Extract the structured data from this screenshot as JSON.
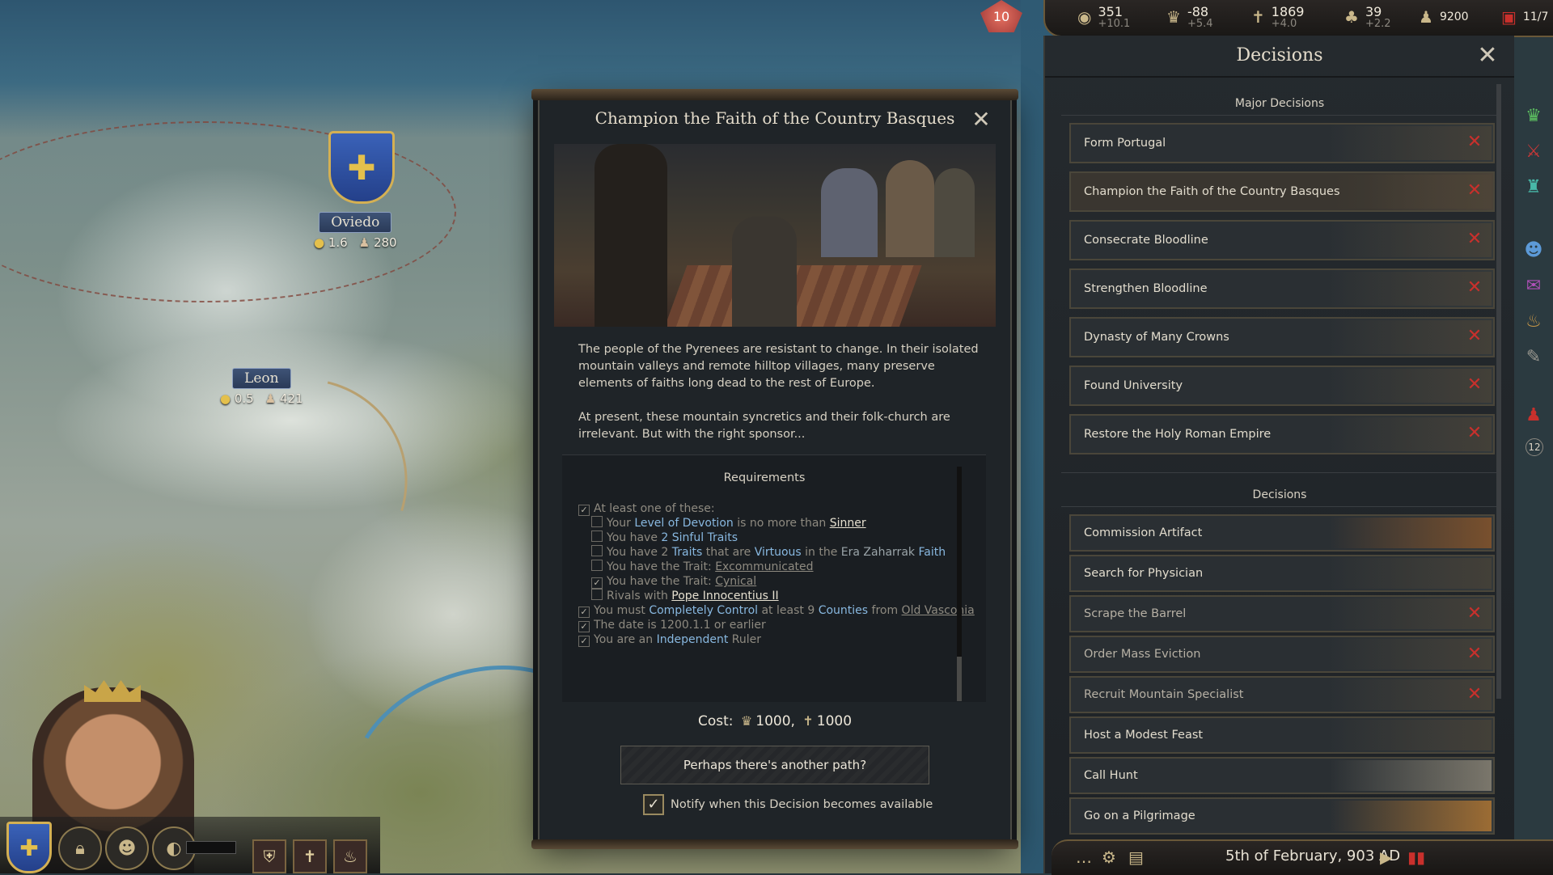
{
  "map": {
    "holdings": [
      {
        "name": "Oviedo",
        "gold": "1.6",
        "levy": "280"
      },
      {
        "name": "Leon",
        "gold": "0.5",
        "levy": "421"
      }
    ]
  },
  "topbar": {
    "gem_value": "10",
    "resources": [
      {
        "icon": "gold-icon",
        "value": "351",
        "delta": "+10.1"
      },
      {
        "icon": "prestige-icon",
        "value": "-88",
        "delta": "+5.4"
      },
      {
        "icon": "piety-icon",
        "value": "1869",
        "delta": "+4.0"
      },
      {
        "icon": "renown-icon",
        "value": "39",
        "delta": "+2.2"
      },
      {
        "icon": "soldiers-icon",
        "value": "9200"
      },
      {
        "icon": "domain-icon",
        "value": "11/7"
      }
    ]
  },
  "dialog": {
    "title": "Champion the Faith of the Country Basques",
    "close": "✕",
    "description": [
      "The people of the Pyrenees are resistant to change. In their isolated mountain valleys and remote hilltop villages, many preserve elements of faiths long dead to the rest of Europe.",
      "At present, these mountain syncretics and their folk-church are irrelevant. But with the right sponsor..."
    ],
    "requirements_title": "Requirements",
    "requirements": {
      "at_least": "At least one of these:",
      "r1": {
        "a": "Your ",
        "b": "Level of Devotion",
        "c": " is no more than ",
        "d": "Sinner"
      },
      "r2": {
        "a": "You have ",
        "b": "2 Sinful Traits"
      },
      "r3": {
        "a": "You have 2 ",
        "b": "Traits",
        "c": " that are ",
        "d": "Virtuous",
        "e": " in the ",
        "f": "Era Zaharrak",
        "g": " Faith"
      },
      "r4": {
        "a": "You have the Trait: ",
        "b": "Excommunicated"
      },
      "r5": {
        "a": "You have the Trait: ",
        "b": "Cynical"
      },
      "r6": {
        "a": "Rivals with ",
        "b": "Pope Innocentius II"
      },
      "r7": {
        "a": "You must ",
        "b": "Completely Control",
        "c": " at least 9 ",
        "d": "Counties",
        "e": " from ",
        "f": "Old Vasconia"
      },
      "r8": "The date is 1200.1.1 or earlier",
      "r9": {
        "a": "You are an ",
        "b": "Independent",
        "c": " Ruler"
      }
    },
    "cost": {
      "label": "Cost:",
      "prestige": "1000,",
      "piety": "1000"
    },
    "path_button": "Perhaps there's another path?",
    "notify_label": "Notify when this Decision becomes available",
    "notify_checked": true
  },
  "panel": {
    "title": "Decisions",
    "close": "✕",
    "major_header": "Major Decisions",
    "major": [
      {
        "label": "Form Portugal",
        "blocked": true
      },
      {
        "label": "Champion the Faith of the Country Basques",
        "blocked": true,
        "active": true
      },
      {
        "label": "Consecrate Bloodline",
        "blocked": true
      },
      {
        "label": "Strengthen Bloodline",
        "blocked": true
      },
      {
        "label": "Dynasty of Many Crowns",
        "blocked": true
      },
      {
        "label": "Found University",
        "blocked": true
      },
      {
        "label": "Restore the Holy Roman Empire",
        "blocked": true
      }
    ],
    "decisions_header": "Decisions",
    "decisions": [
      {
        "label": "Commission Artifact",
        "blocked": false
      },
      {
        "label": "Search for Physician",
        "blocked": false
      },
      {
        "label": "Scrape the Barrel",
        "blocked": true
      },
      {
        "label": "Order Mass Eviction",
        "blocked": true
      },
      {
        "label": "Recruit Mountain Specialist",
        "blocked": true
      },
      {
        "label": "Host a Modest Feast",
        "blocked": false
      },
      {
        "label": "Call Hunt",
        "blocked": false
      },
      {
        "label": "Go on a Pilgrimage",
        "blocked": false
      }
    ]
  },
  "rail": {
    "badge": "12"
  },
  "datebar": {
    "date": "5th of February, 903 AD"
  },
  "colors": {
    "accent_gold": "#c9b78a",
    "blocked_red": "#c8302c",
    "link_blue": "#88b8e0"
  }
}
